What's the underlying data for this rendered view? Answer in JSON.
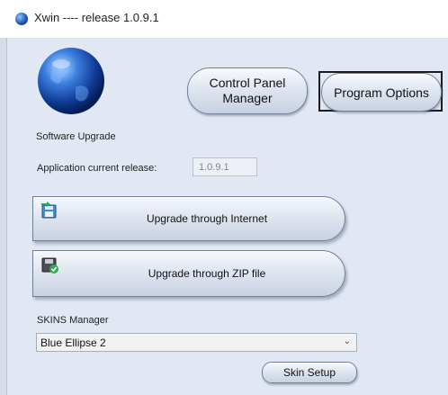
{
  "window": {
    "title": "Xwin ---- release 1.0.9.1"
  },
  "nav": {
    "control_panel_line1": "Control Panel",
    "control_panel_line2": "Manager",
    "program_options": "Program Options"
  },
  "upgrade": {
    "section_label": "Software Upgrade",
    "current_release_label": "Application current release:",
    "current_release_value": "1.0.9.1",
    "internet_button": "Upgrade through Internet",
    "zip_button": "Upgrade through ZIP file"
  },
  "skins": {
    "section_label": "SKINS Manager",
    "selected": "Blue Ellipse 2",
    "setup_button": "Skin Setup"
  },
  "icons": {
    "app": "globe-icon",
    "internet": "internet-upgrade-icon",
    "zip": "zip-file-icon",
    "dropdown": "chevron-down-icon"
  }
}
